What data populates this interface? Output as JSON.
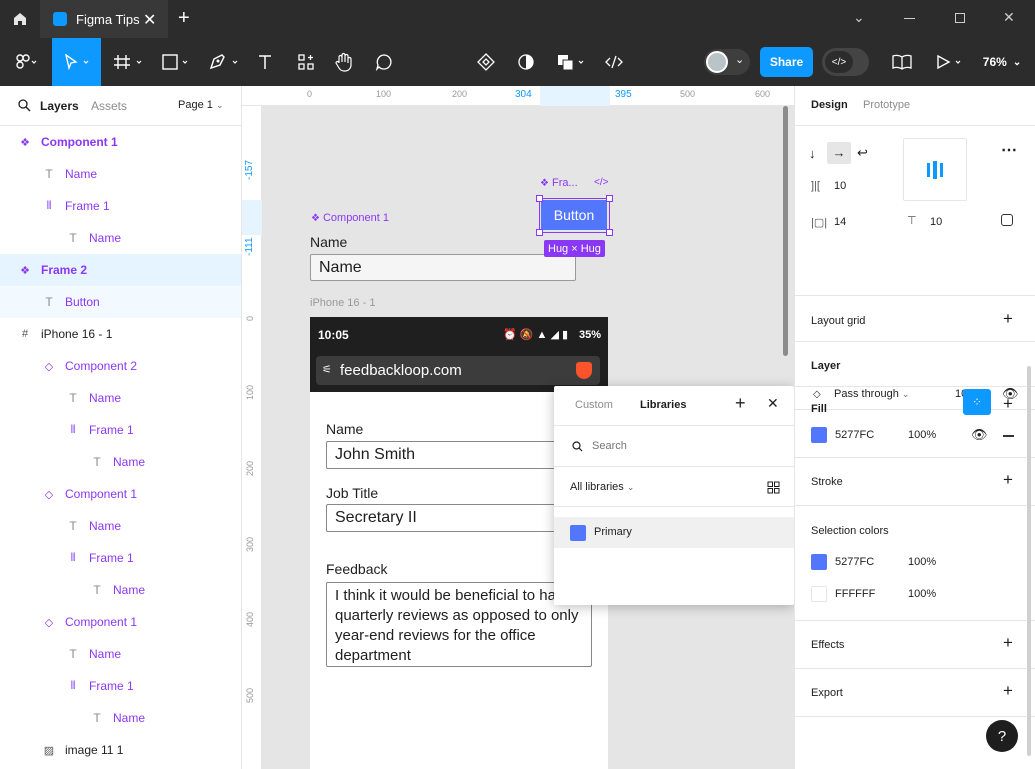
{
  "tabbar": {
    "tab_title": "Figma Tips"
  },
  "toolbar": {
    "share_label": "Share",
    "zoom": "76%"
  },
  "left_panel": {
    "tabs": [
      "Layers",
      "Assets"
    ],
    "page_selector": "Page 1",
    "layers": [
      {
        "name": "Component 1"
      },
      {
        "name": "Name"
      },
      {
        "name": "Frame 1"
      },
      {
        "name": "Name"
      },
      {
        "name": "Frame 2"
      },
      {
        "name": "Button"
      },
      {
        "name": "iPhone 16 - 1"
      },
      {
        "name": "Component 2"
      },
      {
        "name": "Name"
      },
      {
        "name": "Frame 1"
      },
      {
        "name": "Name"
      },
      {
        "name": "Component 1"
      },
      {
        "name": "Name"
      },
      {
        "name": "Frame 1"
      },
      {
        "name": "Name"
      },
      {
        "name": "Component 1"
      },
      {
        "name": "Name"
      },
      {
        "name": "Frame 1"
      },
      {
        "name": "Name"
      },
      {
        "name": "image 11 1"
      }
    ]
  },
  "canvas": {
    "ruler_x": [
      "0",
      "100",
      "200",
      "304",
      "395",
      "500",
      "600"
    ],
    "ruler_y": [
      "-157",
      "-111",
      "0",
      "100",
      "200",
      "300",
      "400",
      "500"
    ],
    "component_label": "Component 1",
    "name_label": "Name",
    "name_field": "Name",
    "frame_label": "Fra...",
    "code_glyph": "</>",
    "button_text": "Button",
    "hug_badge": "Hug × Hug",
    "iphone_label": "iPhone 16 - 1",
    "status_time": "10:05",
    "battery": "35%",
    "url": "feedbackloop.com",
    "form": {
      "name_label": "Name",
      "name_value": "John Smith",
      "job_label": "Job Title",
      "job_value": "Secretary II",
      "feedback_label": "Feedback",
      "feedback_value": "I think it would be beneficial to have quarterly reviews as opposed to only year-end reviews for the office department"
    }
  },
  "libraries_popup": {
    "tabs": [
      "Custom",
      "Libraries"
    ],
    "search_placeholder": "Search",
    "filter": "All libraries",
    "items": [
      {
        "name": "Primary",
        "color": "#5277FC"
      }
    ]
  },
  "right_panel": {
    "tabs": [
      "Design",
      "Prototype"
    ],
    "auto_layout": {
      "gap": "10",
      "padding_h": "14",
      "padding_v": "10"
    },
    "layout_grid": "Layout grid",
    "layer": {
      "title": "Layer",
      "blend": "Pass through",
      "opacity": "100%"
    },
    "fill": {
      "title": "Fill",
      "hex": "5277FC",
      "opacity": "100%",
      "color": "#5277FC"
    },
    "stroke": "Stroke",
    "selection_colors": {
      "title": "Selection colors",
      "items": [
        {
          "hex": "5277FC",
          "opacity": "100%",
          "color": "#5277FC"
        },
        {
          "hex": "FFFFFF",
          "opacity": "100%",
          "color": "#FFFFFF"
        }
      ]
    },
    "effects": "Effects",
    "export": "Export",
    "help": "?"
  },
  "colors": {
    "accent": "#0d99ff",
    "component": "#8a38f5",
    "fill": "#5277FC"
  }
}
